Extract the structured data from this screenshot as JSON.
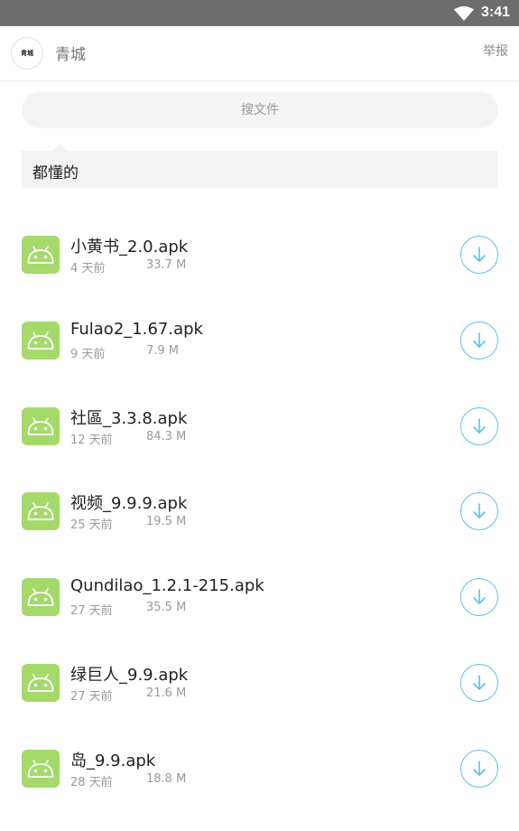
{
  "status_bar": {
    "time": "3:41"
  },
  "app_bar": {
    "avatar_text": "青城",
    "title": "青城",
    "report_label": "举报"
  },
  "search": {
    "placeholder": "搜文件"
  },
  "folder": {
    "name": "都懂的"
  },
  "files": [
    {
      "name": "小黄书_2.0.apk",
      "date": "4 天前",
      "size": "33.7 M"
    },
    {
      "name": "Fulao2_1.67.apk",
      "date": "9 天前",
      "size": "7.9 M"
    },
    {
      "name": "社區_3.3.8.apk",
      "date": "12 天前",
      "size": "84.3 M"
    },
    {
      "name": "视频_9.9.9.apk",
      "date": "25 天前",
      "size": "19.5 M"
    },
    {
      "name": "Qundilao_1.2.1-215.apk",
      "date": "27 天前",
      "size": "35.5 M"
    },
    {
      "name": "绿巨人_9.9.apk",
      "date": "27 天前",
      "size": "21.6 M"
    },
    {
      "name": "岛_9.9.apk",
      "date": "28 天前",
      "size": "18.8 M"
    }
  ],
  "colors": {
    "status_bar": "#6d6d6d",
    "apk_icon": "#a5d96a",
    "download_accent": "#5bc2e7"
  },
  "icons": {
    "file": "android-icon",
    "download": "download-arrow-icon",
    "wifi": "wifi-icon"
  }
}
